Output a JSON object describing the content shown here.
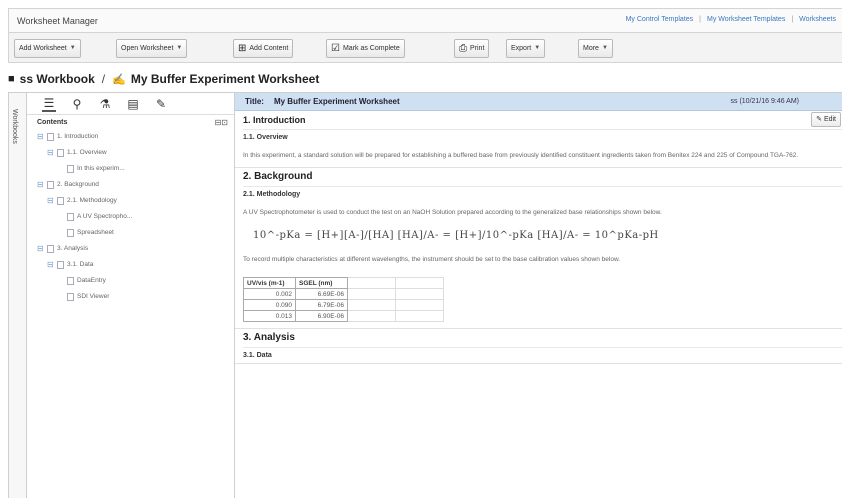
{
  "app": {
    "title": "Worksheet Manager",
    "links": [
      "My Control Templates",
      "My Worksheet Templates",
      "Worksheets"
    ]
  },
  "toolbar": {
    "add_worksheet": "Add Worksheet",
    "open_worksheet": "Open Worksheet",
    "add_content": "Add Content",
    "mark_complete": "Mark as Complete",
    "print": "Print",
    "export": "Export",
    "more": "More"
  },
  "breadcrumb": {
    "workbook": "ss Workbook",
    "separator": "/",
    "worksheet": "My Buffer Experiment Worksheet"
  },
  "side_tab": "Workbooks",
  "contents": {
    "heading": "Contents",
    "tree": [
      {
        "label": "1. Introduction",
        "level": 0
      },
      {
        "label": "1.1. Overview",
        "level": 1
      },
      {
        "label": "In this experim...",
        "level": 2
      },
      {
        "label": "2. Background",
        "level": 0
      },
      {
        "label": "2.1. Methodology",
        "level": 1
      },
      {
        "label": "A UV Spectropho...",
        "level": 2
      },
      {
        "label": "Spreadsheet",
        "level": 2
      },
      {
        "label": "3. Analysis",
        "level": 0
      },
      {
        "label": "3.1. Data",
        "level": 1
      },
      {
        "label": "DataEntry",
        "level": 2
      },
      {
        "label": "SDI Viewer",
        "level": 2
      }
    ]
  },
  "worksheet": {
    "title_label": "Title:",
    "title": "My Buffer Experiment Worksheet",
    "timestamp": "ss (10/21/16 9:46 AM)",
    "edit": "Edit",
    "s1": "1. Introduction",
    "s1_1": "1.1. Overview",
    "s1_text": "In this experiment, a standard solution will be prepared for establishing a buffered base from previously identified constituent ingredients taken from Benitex 224 and 225 of Compound TGA-762.",
    "s2": "2. Background",
    "s2_1": "2.1. Methodology",
    "s2_text": "A UV Spectrophotometer is used to conduct the test on an NaOH Solution prepared according to the generalized base relationships shown below.",
    "formula": "10^-pKa = [H+][A-]/[HA]   [HA]/A- = [H+]/10^-pKa   [HA]/A- = 10^pKa-pH",
    "s2_text2": "To record multiple characteristics at different wavelengths, the instrument should be set to the base calibration values shown below.",
    "table_headers": [
      "UV/vis (m-1)",
      "SGEL (nm)"
    ],
    "table_rows": [
      [
        "0.002",
        "6.69E-06"
      ],
      [
        "0.090",
        "6.79E-06"
      ],
      [
        "0.013",
        "6.90E-06"
      ]
    ],
    "s3": "3. Analysis",
    "s3_1": "3.1. Data"
  }
}
